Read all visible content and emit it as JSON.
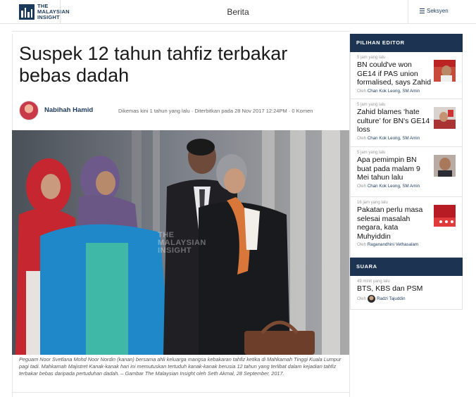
{
  "header": {
    "logo_line1": "THE",
    "logo_line2": "MALAYSIAN",
    "logo_line3": "INSIGHT",
    "nav_label": "Berita",
    "menu_label": "Seksyen"
  },
  "article": {
    "title": "Suspek 12 tahun tahfiz terbakar bebas dadah",
    "author": "Nabihah Hamid",
    "meta": "Dikemas kini 1 tahun yang lalu · Diterbitkan pada 28 Nov 2017 12:24PM · 0 Komen",
    "watermark_line1": "THE",
    "watermark_line2": "MALAYSIAN",
    "watermark_line3": "INSIGHT",
    "caption": "Peguam Noor Svetlana Mohd Noor Nordin (kanan) bersama ahli keluarga mangsa kebakaran tahfiz ketika di Mahkamah Tinggi Kuala Lumpur pagi tadi. Mahkamah Majistret Kanak-kanak hari ini memutuskan tertuduh kanak-kanak berusia 12 tahun yang terlibat dalam kejadian tahfiz terbakar bebas daripada pertuduhan dadah. – Gambar The Malaysian Insight oleh Seth Akmal, 28 September, 2017."
  },
  "sidebar": {
    "editor_heading": "PILIHAN EDITOR",
    "editor_items": [
      {
        "time": "5 jam yang lalu",
        "title": "BN could've won GE14 if PAS union formalised, says Zahid",
        "by": "Oleh",
        "authors": "Chan Kok Leong, SM Amin"
      },
      {
        "time": "5 jam yang lalu",
        "title": "Zahid blames ‘hate culture’ for BN's GE14 loss",
        "by": "Oleh",
        "authors": "Chan Kok Leong, SM Amin"
      },
      {
        "time": "5 jam yang lalu",
        "title": "Apa pemimpin BN buat pada malam 9 Mei tahun lalu",
        "by": "Oleh",
        "authors": "Chan Kok Leong, SM Amin"
      },
      {
        "time": "16 jam yang lalu",
        "title": "Pakatan perlu masa selesai masalah negara, kata Muhyiddin",
        "by": "Oleh",
        "authors": "Raganandhini Vethasalam"
      }
    ],
    "suara_heading": "SUARA",
    "suara_item": {
      "time": "49 minit yang lalu",
      "title": "BTS, KBS dan PSM",
      "by": "Oleh",
      "author": "Radzi Tajuddin"
    }
  },
  "colors": {
    "brand_navy": "#1c3452",
    "link_blue": "#1b3a5b"
  },
  "icons": {
    "menu": "hamburger-icon"
  }
}
